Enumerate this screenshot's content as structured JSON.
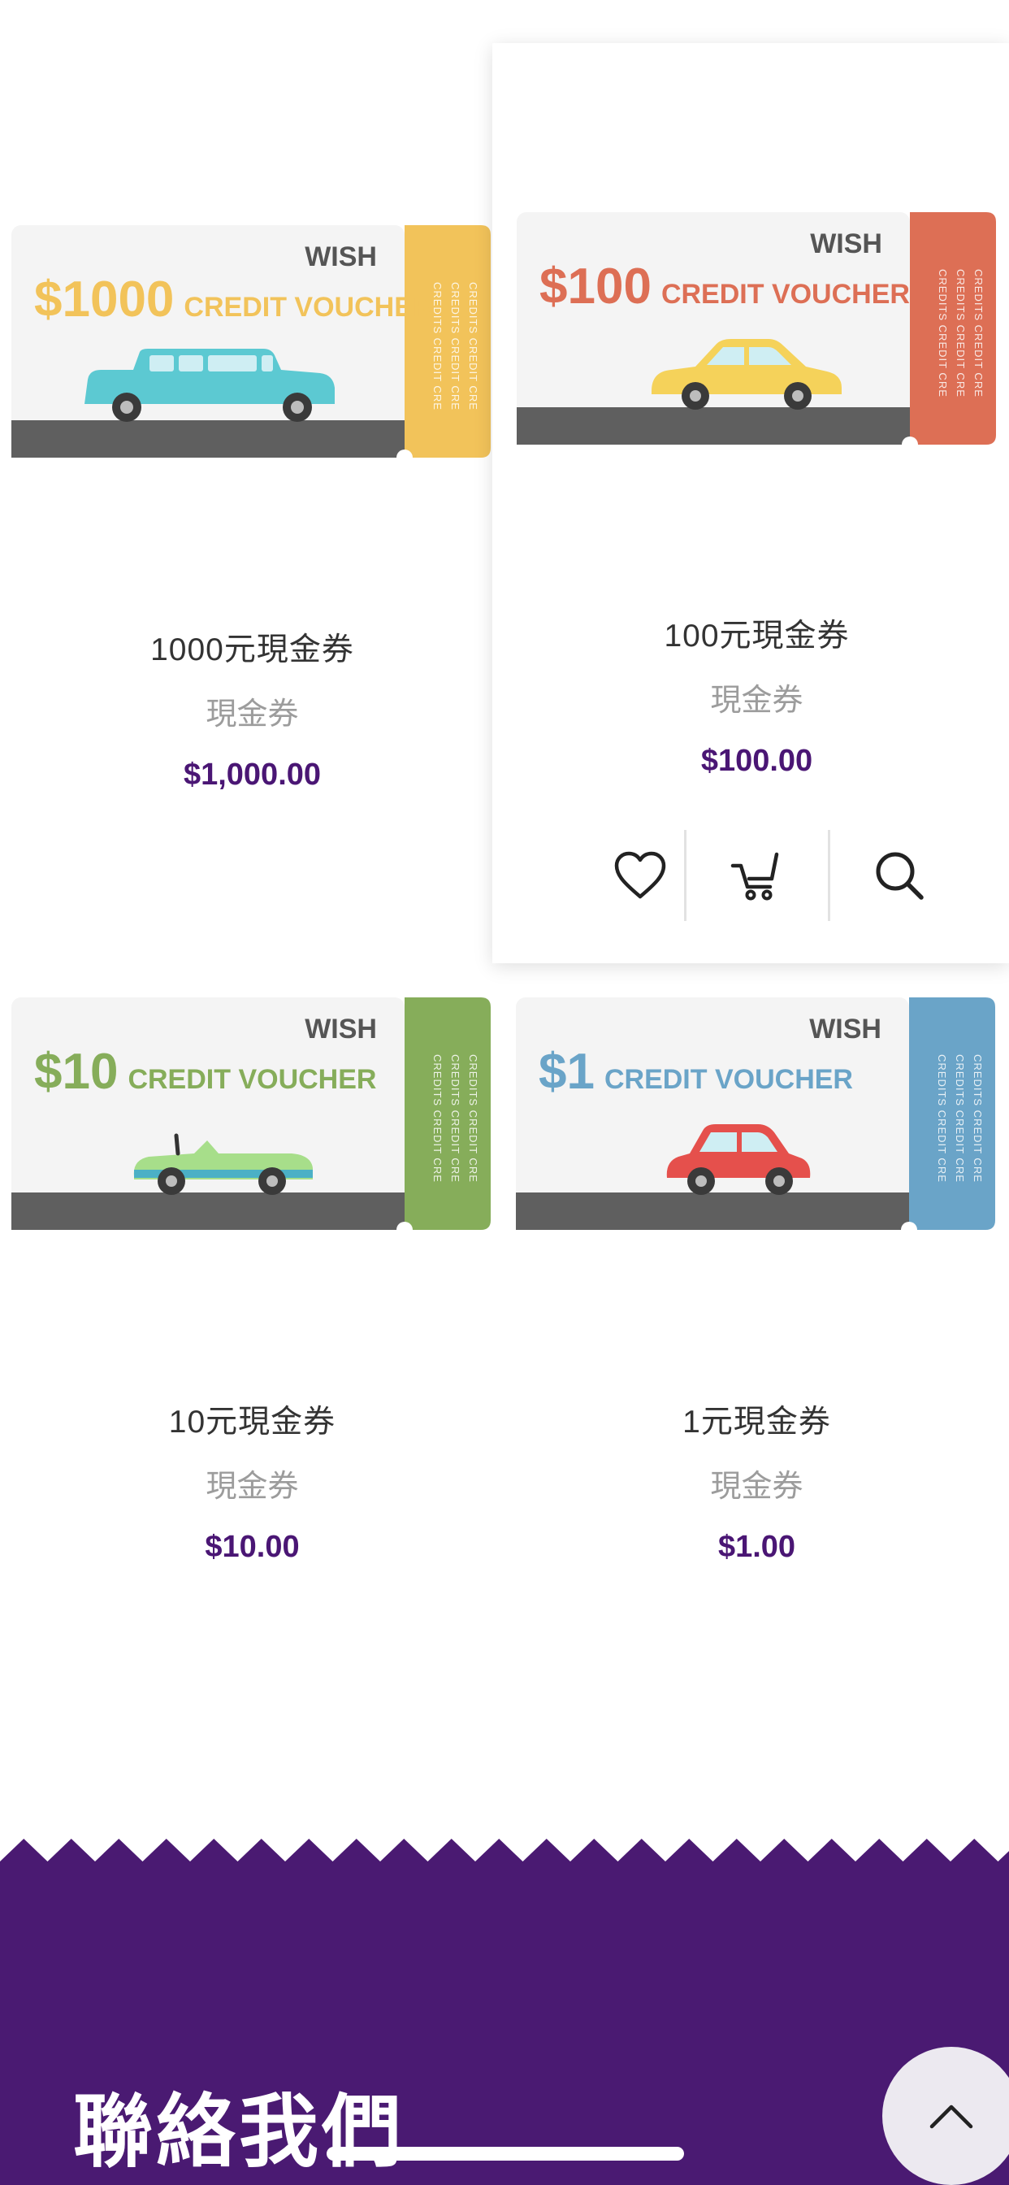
{
  "products": [
    {
      "name": "1000元現金券",
      "category": "現金券",
      "price": "$1,000.00",
      "voucher": {
        "amount": "$1000",
        "label": "CREDIT VOUCHER",
        "brand": "WISH",
        "color": "#f2c35a",
        "car": "limousine",
        "car_color": "#5cc9d2"
      }
    },
    {
      "name": "100元現金券",
      "category": "現金券",
      "price": "$100.00",
      "voucher": {
        "amount": "$100",
        "label": "CREDIT VOUCHER",
        "brand": "WISH",
        "color": "#dd6f55",
        "car": "sedan",
        "car_color": "#f5d25a"
      }
    },
    {
      "name": "10元現金券",
      "category": "現金券",
      "price": "$10.00",
      "voucher": {
        "amount": "$10",
        "label": "CREDIT VOUCHER",
        "brand": "WISH",
        "color": "#86ad5a",
        "car": "convertible",
        "car_color": "#a7de8a"
      }
    },
    {
      "name": "1元現金券",
      "category": "現金券",
      "price": "$1.00",
      "voucher": {
        "amount": "$1",
        "label": "CREDIT VOUCHER",
        "brand": "WISH",
        "color": "#6aa4c8",
        "car": "hatchback",
        "car_color": "#e5504c"
      }
    }
  ],
  "stub_text": "CREDITS CREDIT CRE",
  "actions": {
    "wishlist_icon": "heart-icon",
    "cart_icon": "cart-icon",
    "quickview_icon": "search-icon"
  },
  "footer": {
    "title": "聯絡我們",
    "background": "#4a1a72",
    "back_to_top_icon": "chevron-up-icon"
  }
}
